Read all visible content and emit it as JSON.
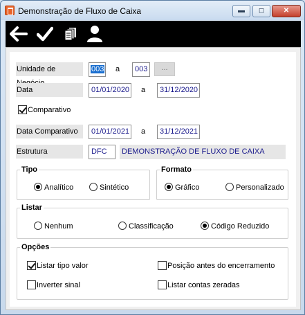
{
  "window": {
    "title": "Demonstração de Fluxo de Caixa",
    "minimize_label": "▬",
    "maximize_label": "◻",
    "close_label": "✕"
  },
  "toolbar": {
    "buttons": [
      "back-arrow-icon",
      "check-icon",
      "copy-icon",
      "user-icon"
    ]
  },
  "form": {
    "unidade": {
      "label": "Unidade de Negócio",
      "from": "003",
      "between": "a",
      "to": "003",
      "browse": "..."
    },
    "data": {
      "label": "Data",
      "from": "01/01/2020",
      "between": "a",
      "to": "31/12/2020"
    },
    "comparativo": {
      "label": "Comparativo",
      "checked": true
    },
    "data_comparativo": {
      "label": "Data Comparativo",
      "from": "01/01/2021",
      "between": "a",
      "to": "31/12/2021"
    },
    "estrutura": {
      "label": "Estrutura",
      "code": "DFC",
      "description": "DEMONSTRAÇÃO DE FLUXO DE CAIXA"
    }
  },
  "tipo": {
    "title": "Tipo",
    "options": [
      "Analítico",
      "Sintético"
    ],
    "selected": "Analítico"
  },
  "formato": {
    "title": "Formato",
    "options": [
      "Gráfico",
      "Personalizado"
    ],
    "selected": "Gráfico"
  },
  "listar": {
    "title": "Listar",
    "options": [
      "Nenhum",
      "Classificação",
      "Código Reduzido"
    ],
    "selected": "Código Reduzido"
  },
  "opcoes": {
    "title": "Opções",
    "listar_tipo_valor": {
      "label": "Listar tipo valor",
      "checked": true
    },
    "posicao_antes": {
      "label": "Posição antes do encerramento",
      "checked": false
    },
    "inverter_sinal": {
      "label": "Inverter sinal",
      "checked": false
    },
    "listar_contas_zeradas": {
      "label": "Listar contas zeradas",
      "checked": false
    }
  }
}
